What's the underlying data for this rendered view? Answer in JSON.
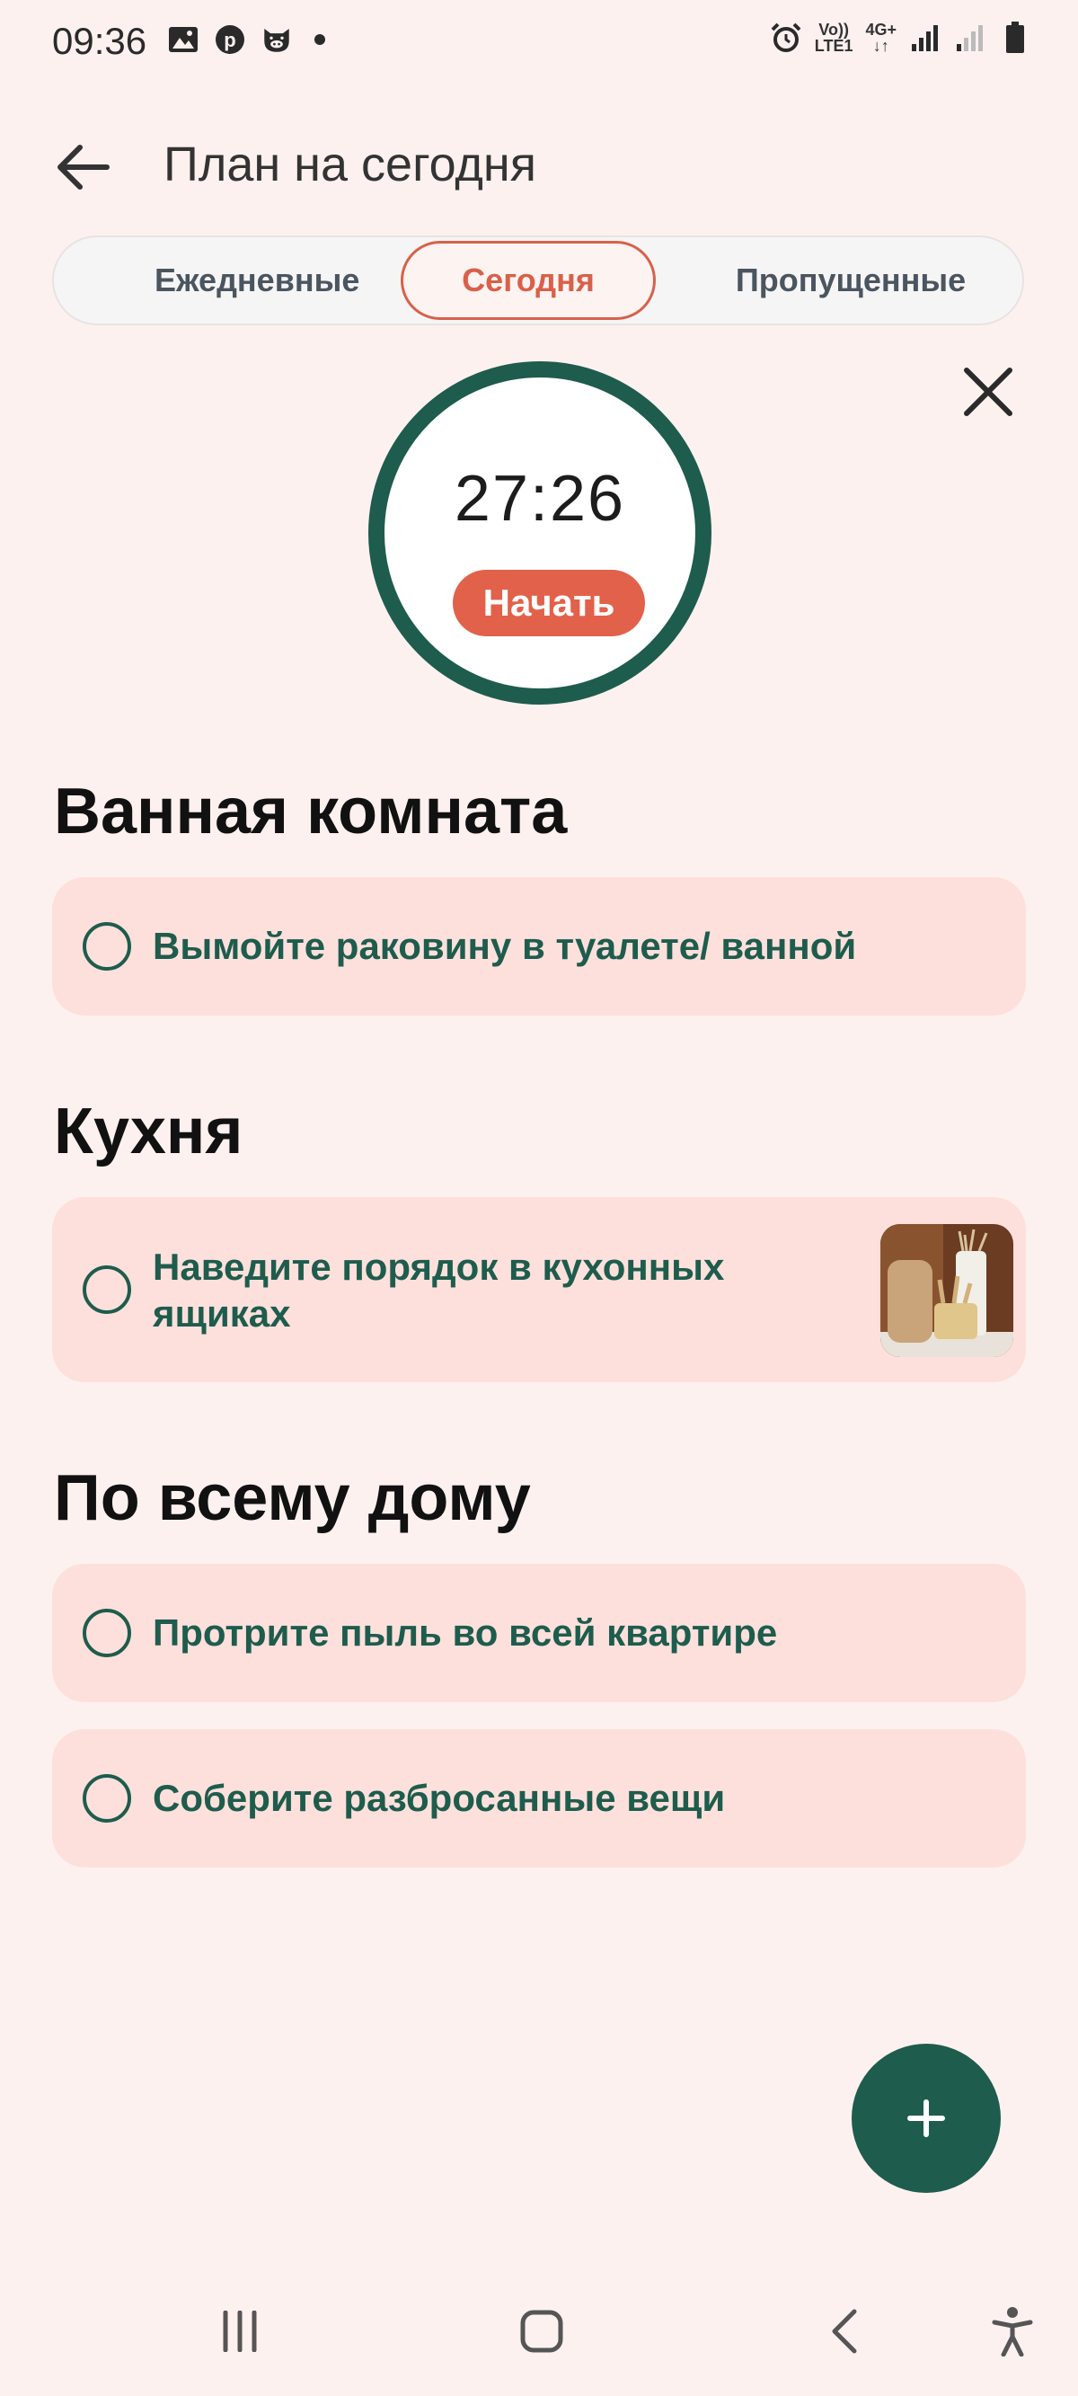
{
  "status_bar": {
    "time": "09:36",
    "icons": [
      "image-icon",
      "pinterest-icon",
      "pig-icon",
      "dot-icon",
      "alarm-icon",
      "volte-icon",
      "4g-icon",
      "signal-icon",
      "signal-weak-icon",
      "battery-icon"
    ],
    "volte_label": "Vo))\nLTE1",
    "network_label": "4G+"
  },
  "header": {
    "title": "План на сегодня"
  },
  "tabs": [
    {
      "label": "Ежедневные",
      "active": false
    },
    {
      "label": "Сегодня",
      "active": true
    },
    {
      "label": "Пропущенные",
      "active": false
    }
  ],
  "timer": {
    "value": "27:26",
    "start_label": "Начать"
  },
  "sections": [
    {
      "title": "Ванная комната",
      "tasks": [
        {
          "label": "Вымойте раковину в туалете/ ванной",
          "has_image": false
        }
      ]
    },
    {
      "title": "Кухня",
      "tasks": [
        {
          "label": "Наведите порядок в кухонных ящиках",
          "has_image": true
        }
      ]
    },
    {
      "title": "По всему дому",
      "tasks": [
        {
          "label": "Протрите пыль во всей квартире",
          "has_image": false
        },
        {
          "label": "Соберите разбросанные вещи",
          "has_image": false
        }
      ]
    }
  ],
  "colors": {
    "background": "#fdf1ef",
    "accent_green": "#1e5c4d",
    "accent_red": "#e2614a",
    "card": "#fde0dc"
  }
}
